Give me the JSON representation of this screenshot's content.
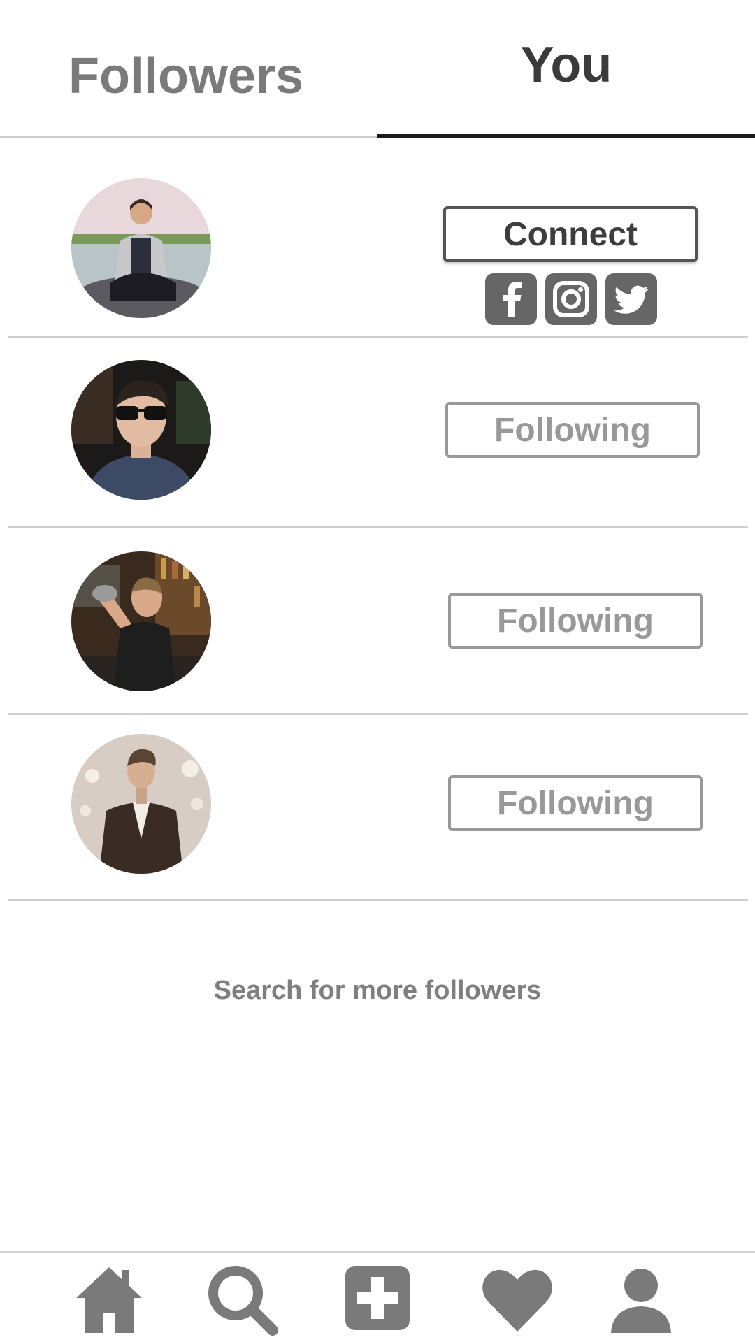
{
  "tabs": {
    "followers_label": "Followers",
    "you_label": "You",
    "active": "You"
  },
  "rows": [
    {
      "button_label": "Connect",
      "button_type": "connect",
      "social": [
        "facebook-icon",
        "instagram-icon",
        "twitter-icon"
      ]
    },
    {
      "button_label": "Following",
      "button_type": "following"
    },
    {
      "button_label": "Following",
      "button_type": "following"
    },
    {
      "button_label": "Following",
      "button_type": "following"
    }
  ],
  "search_more": "Search for more followers",
  "nav": [
    "home-icon",
    "search-icon",
    "add-icon",
    "heart-icon",
    "profile-icon"
  ],
  "colors": {
    "icon_gray": "#7a7a7a",
    "active_tab": "#1a1a1a",
    "button_border_active": "#555555",
    "button_border_muted": "#999999"
  }
}
